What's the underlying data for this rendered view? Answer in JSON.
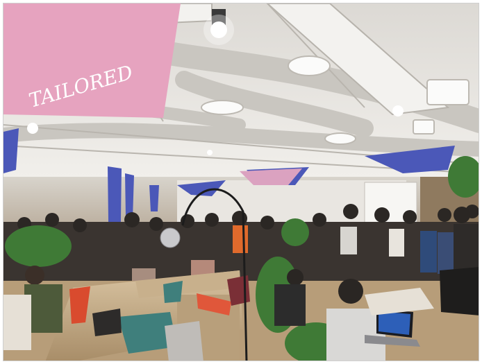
{
  "scene": {
    "banner_text": "TAILORED",
    "banner_color": "#e6a3bf",
    "hanging_banner_color": "#4b58b8",
    "ceiling_color": "#e9e7e3",
    "sofa_color": "#c9b290",
    "floor_color": "#b79d79"
  }
}
